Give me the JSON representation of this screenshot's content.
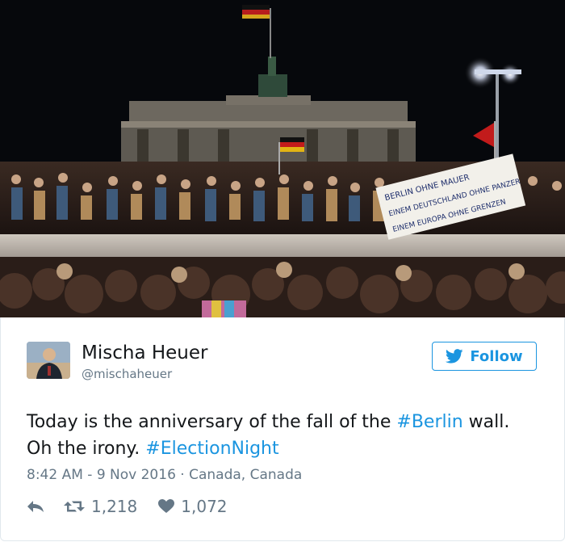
{
  "tweet": {
    "author_name": "Mischa Heuer",
    "author_handle": "@mischaheuer",
    "follow_label": "Follow",
    "text_prefix": "Today is the anniversary of the fall of the ",
    "hashtag_1": "#Berlin",
    "text_middle": " wall. Oh the irony. ",
    "hashtag_2": "#ElectionNight",
    "time": "8:42 AM - 9 Nov 2016",
    "separator": " · ",
    "location": "Canada, Canada",
    "retweets": "1,218",
    "likes": "1,072"
  },
  "photo": {
    "banner_text_line1": "BERLIN OHNE MAUER",
    "banner_text_line2": "EINEM DEUTSCHLAND OHNE PANZER",
    "banner_text_line3": "EINEM EUROPA OHNE GRENZEN"
  },
  "colors": {
    "accent": "#1b95e0",
    "text": "#14171a",
    "muted": "#657786"
  }
}
